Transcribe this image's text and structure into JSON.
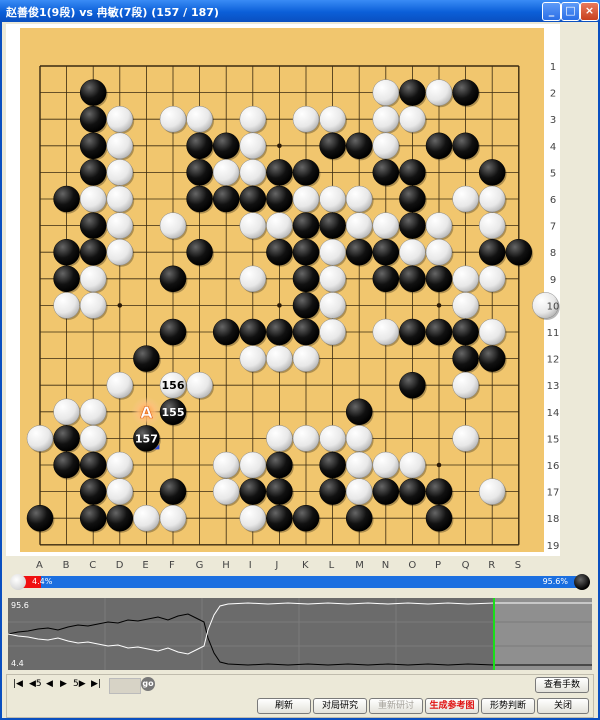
{
  "window": {
    "title": "赵善俊1(9段) vs 冉敏(7段) (157 / 187)",
    "minimize_label": "_",
    "maximize_label": "□",
    "close_label": "×"
  },
  "board": {
    "size": 19,
    "col_labels": [
      "A",
      "B",
      "C",
      "D",
      "E",
      "F",
      "G",
      "H",
      "I",
      "J",
      "K",
      "L",
      "M",
      "N",
      "O",
      "P",
      "Q",
      "R",
      "S"
    ],
    "row_labels": [
      "1",
      "2",
      "3",
      "4",
      "5",
      "6",
      "7",
      "8",
      "9",
      "10",
      "11",
      "12",
      "13",
      "14",
      "15",
      "16",
      "17",
      "18",
      "19"
    ],
    "hoshi": [
      [
        3,
        3
      ],
      [
        9,
        3
      ],
      [
        15,
        3
      ],
      [
        3,
        9
      ],
      [
        9,
        9
      ],
      [
        15,
        9
      ],
      [
        3,
        15
      ],
      [
        9,
        15
      ],
      [
        15,
        15
      ]
    ],
    "black": [
      [
        2,
        1
      ],
      [
        14,
        1
      ],
      [
        16,
        1
      ],
      [
        2,
        2
      ],
      [
        2,
        3
      ],
      [
        6,
        3
      ],
      [
        7,
        3
      ],
      [
        11,
        3
      ],
      [
        12,
        3
      ],
      [
        15,
        3
      ],
      [
        16,
        3
      ],
      [
        2,
        4
      ],
      [
        6,
        4
      ],
      [
        9,
        4
      ],
      [
        10,
        4
      ],
      [
        13,
        4
      ],
      [
        14,
        4
      ],
      [
        17,
        4
      ],
      [
        1,
        5
      ],
      [
        6,
        5
      ],
      [
        7,
        5
      ],
      [
        8,
        5
      ],
      [
        9,
        5
      ],
      [
        14,
        5
      ],
      [
        2,
        6
      ],
      [
        10,
        6
      ],
      [
        11,
        6
      ],
      [
        14,
        6
      ],
      [
        1,
        7
      ],
      [
        2,
        7
      ],
      [
        6,
        7
      ],
      [
        9,
        7
      ],
      [
        10,
        7
      ],
      [
        12,
        7
      ],
      [
        13,
        7
      ],
      [
        17,
        7
      ],
      [
        18,
        7
      ],
      [
        1,
        8
      ],
      [
        5,
        8
      ],
      [
        10,
        8
      ],
      [
        13,
        8
      ],
      [
        14,
        8
      ],
      [
        15,
        8
      ],
      [
        10,
        9
      ],
      [
        5,
        10
      ],
      [
        7,
        10
      ],
      [
        8,
        10
      ],
      [
        9,
        10
      ],
      [
        10,
        10
      ],
      [
        14,
        10
      ],
      [
        15,
        10
      ],
      [
        16,
        10
      ],
      [
        4,
        11
      ],
      [
        16,
        11
      ],
      [
        17,
        11
      ],
      [
        14,
        12
      ],
      [
        12,
        13
      ],
      [
        1,
        14
      ],
      [
        1,
        15
      ],
      [
        2,
        15
      ],
      [
        9,
        15
      ],
      [
        11,
        15
      ],
      [
        2,
        16
      ],
      [
        5,
        16
      ],
      [
        8,
        16
      ],
      [
        9,
        16
      ],
      [
        11,
        16
      ],
      [
        13,
        16
      ],
      [
        14,
        16
      ],
      [
        15,
        16
      ],
      [
        0,
        17
      ],
      [
        2,
        17
      ],
      [
        3,
        17
      ],
      [
        9,
        17
      ],
      [
        10,
        17
      ],
      [
        12,
        17
      ],
      [
        15,
        17
      ]
    ],
    "white": [
      [
        13,
        1
      ],
      [
        15,
        1
      ],
      [
        3,
        2
      ],
      [
        5,
        2
      ],
      [
        6,
        2
      ],
      [
        8,
        2
      ],
      [
        10,
        2
      ],
      [
        11,
        2
      ],
      [
        13,
        2
      ],
      [
        14,
        2
      ],
      [
        3,
        3
      ],
      [
        8,
        3
      ],
      [
        13,
        3
      ],
      [
        3,
        4
      ],
      [
        7,
        4
      ],
      [
        8,
        4
      ],
      [
        2,
        5
      ],
      [
        3,
        5
      ],
      [
        10,
        5
      ],
      [
        11,
        5
      ],
      [
        12,
        5
      ],
      [
        16,
        5
      ],
      [
        17,
        5
      ],
      [
        3,
        6
      ],
      [
        5,
        6
      ],
      [
        8,
        6
      ],
      [
        9,
        6
      ],
      [
        12,
        6
      ],
      [
        13,
        6
      ],
      [
        15,
        6
      ],
      [
        17,
        6
      ],
      [
        3,
        7
      ],
      [
        11,
        7
      ],
      [
        14,
        7
      ],
      [
        15,
        7
      ],
      [
        2,
        8
      ],
      [
        8,
        8
      ],
      [
        11,
        8
      ],
      [
        16,
        8
      ],
      [
        17,
        8
      ],
      [
        1,
        9
      ],
      [
        2,
        9
      ],
      [
        11,
        9
      ],
      [
        16,
        9
      ],
      [
        19,
        9
      ],
      [
        11,
        10
      ],
      [
        13,
        10
      ],
      [
        17,
        10
      ],
      [
        8,
        11
      ],
      [
        9,
        11
      ],
      [
        10,
        11
      ],
      [
        3,
        12
      ],
      [
        6,
        12
      ],
      [
        16,
        12
      ],
      [
        1,
        13
      ],
      [
        2,
        13
      ],
      [
        0,
        14
      ],
      [
        2,
        14
      ],
      [
        9,
        14
      ],
      [
        10,
        14
      ],
      [
        11,
        14
      ],
      [
        12,
        14
      ],
      [
        16,
        14
      ],
      [
        3,
        15
      ],
      [
        7,
        15
      ],
      [
        8,
        15
      ],
      [
        12,
        15
      ],
      [
        13,
        15
      ],
      [
        14,
        15
      ],
      [
        3,
        16
      ],
      [
        7,
        16
      ],
      [
        12,
        16
      ],
      [
        17,
        16
      ],
      [
        4,
        17
      ],
      [
        5,
        17
      ],
      [
        8,
        17
      ]
    ],
    "labeled_stones": [
      {
        "color": "white",
        "col": 5,
        "row": 12,
        "label": "156"
      },
      {
        "color": "black",
        "col": 5,
        "row": 13,
        "label": "155"
      },
      {
        "color": "black",
        "col": 4,
        "row": 14,
        "label": "157"
      }
    ],
    "candidate_marker": {
      "col": 4,
      "row": 13,
      "label": "A"
    }
  },
  "winrate": {
    "left_text": "4.4%",
    "right_text": "95.6%",
    "white_pct": 4.4,
    "black_pct": 95.6
  },
  "graph": {
    "top_label": "95.6",
    "bottom_label": "4.4",
    "current_move": 157,
    "total_moves": 187
  },
  "controls": {
    "first_icon": "|◀",
    "back5_label": "◀5",
    "back1_icon": "◀",
    "fwd1_icon": "▶",
    "fwd5_label": "5▶",
    "last_icon": "▶|",
    "move_input_value": "",
    "go_label": "go",
    "buttons": {
      "refresh": "刷新",
      "study": "对局研究",
      "restudy": "重新研讨",
      "generate": "生成参考图",
      "judge": "形势判断",
      "close": "关闭",
      "view_moves": "查看手数"
    }
  }
}
